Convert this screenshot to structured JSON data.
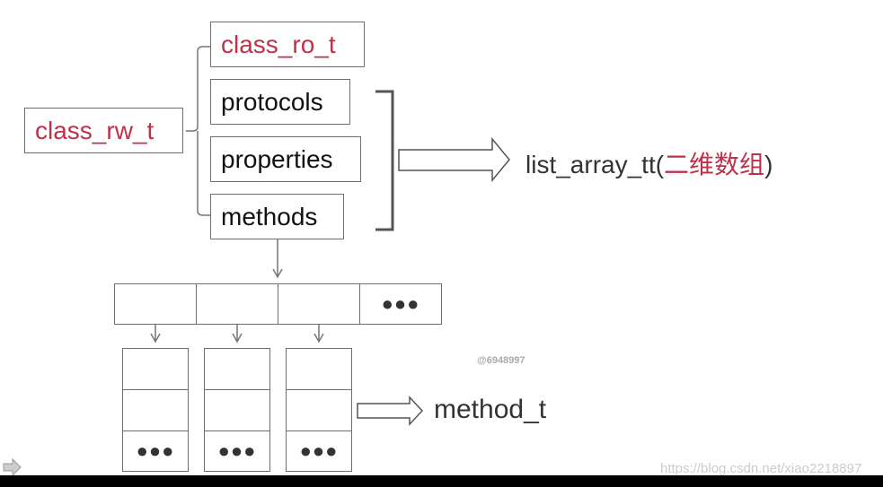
{
  "diagram": {
    "root": {
      "label": "class_rw_t"
    },
    "ro": {
      "label": "class_ro_t"
    },
    "members": [
      {
        "label": "protocols"
      },
      {
        "label": "properties"
      },
      {
        "label": "methods"
      }
    ],
    "list_type": {
      "label": "list_array_tt(",
      "note": "二维数组",
      "close": ")"
    },
    "array_cells": [
      "",
      "",
      "",
      "●●●"
    ],
    "columns": [
      [
        "",
        "",
        "●●●"
      ],
      [
        "",
        "",
        "●●●"
      ],
      [
        "",
        "",
        "●●●"
      ]
    ],
    "element_type": {
      "label": "method_t"
    }
  },
  "watermark": "@6948997",
  "source_url": "https://blog.csdn.net/xiao2218897",
  "colors": {
    "accent_red": "#c0304a",
    "border": "#6e6e6e"
  }
}
